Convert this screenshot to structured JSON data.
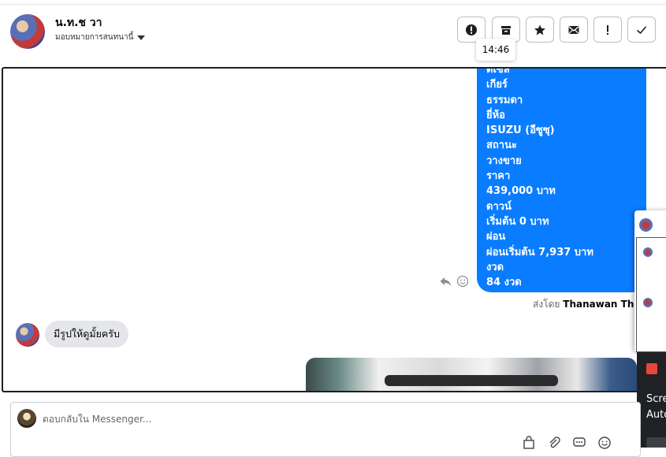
{
  "header": {
    "contact_name": "น.ท.ช วา",
    "assign_label": "มอบหมายการสนทนานี้",
    "tooltip_time": "14:46",
    "toolbar": [
      {
        "name": "report-button",
        "icon": "alert-circle-icon"
      },
      {
        "name": "archive-button",
        "icon": "inbox-icon"
      },
      {
        "name": "star-button",
        "icon": "star-icon"
      },
      {
        "name": "mark-unread-button",
        "icon": "envelope-icon"
      },
      {
        "name": "important-button",
        "icon": "exclamation-icon"
      },
      {
        "name": "done-button",
        "icon": "checkmark-icon"
      }
    ]
  },
  "thread": {
    "outgoing_lines": [
      "ดีเซล",
      "เกียร์",
      "ธรรมดา",
      "ยี่ห้อ",
      "ISUZU (อีซูซุ)",
      "สถานะ",
      "วางขาย",
      "ราคา",
      "439,000 บาท",
      "ดาวน์",
      "เริ่มต้น 0 บาท",
      "ผ่อน",
      "ผ่อนเริ่มต้น 7,937 บาท",
      "งวด",
      "84 งวด"
    ],
    "sent_by_prefix": "ส่งโดย",
    "sent_by_name": "Thanawan Thon",
    "incoming_message": "มีรูปให้ดูมั้ยครับ"
  },
  "side_panel": {
    "line1": "Scre",
    "line2": "Auto"
  },
  "composer": {
    "placeholder": "ตอบกลับใน Messenger..."
  },
  "colors": {
    "outgoing_bubble": "#0a7cff",
    "incoming_bubble": "#e4e6eb",
    "border": "#1c1e21"
  }
}
